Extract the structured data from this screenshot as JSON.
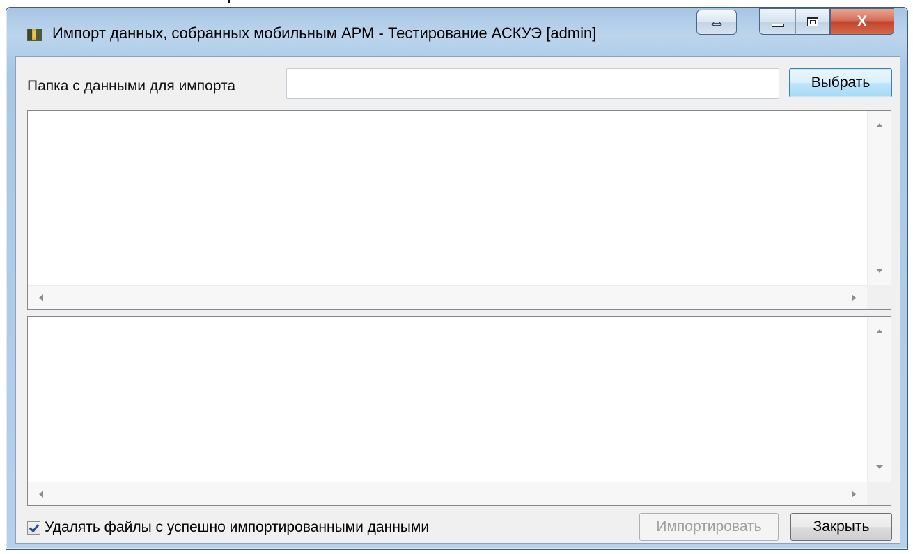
{
  "window": {
    "title": "Импорт данных, собранных мобильным АРМ - Тестирование АСКУЭ [admin]"
  },
  "icons": {
    "app": "app-icon",
    "swap": "swap-arrows-icon",
    "minimize": "minimize-icon",
    "maximize": "maximize-icon",
    "close": "close-icon"
  },
  "caption": {
    "swap_glyph": "⇔",
    "close_glyph": "X"
  },
  "folder": {
    "label": "Папка с данными для импорта",
    "value": "",
    "select_button": "Выбрать"
  },
  "options": {
    "delete_files_label": "Удалять файлы с успешно импортированными данными",
    "delete_files_checked": true
  },
  "buttons": {
    "import": "Импортировать",
    "close": "Закрыть"
  }
}
